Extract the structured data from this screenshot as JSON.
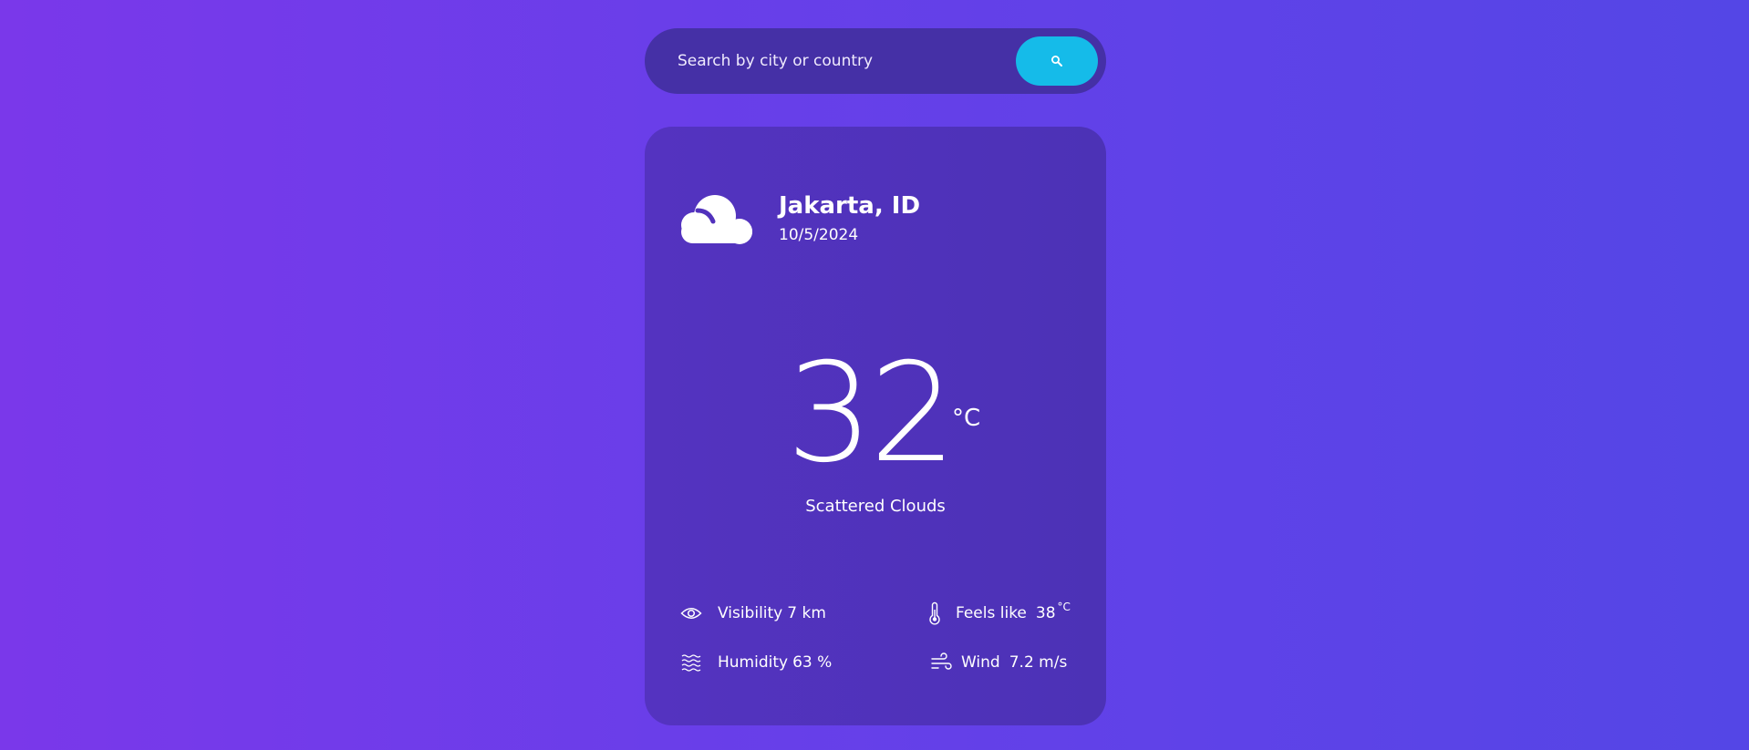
{
  "search": {
    "placeholder": "Search by city or country",
    "button_icon": "search-icon"
  },
  "weather": {
    "icon": "cloud-icon",
    "city": "Jakarta, ID",
    "date": "10/5/2024",
    "temperature": "32",
    "temperature_unit": "°C",
    "condition": "Scattered Clouds"
  },
  "stats": {
    "visibility": {
      "icon": "eye-icon",
      "label": "Visibility",
      "value": "7 km"
    },
    "humidity": {
      "icon": "waves-icon",
      "label": "Humidity",
      "value": "63 %"
    },
    "feels_like": {
      "icon": "thermometer-icon",
      "label": "Feels like",
      "value": "38",
      "unit": "°C"
    },
    "wind": {
      "icon": "wind-icon",
      "label": "Wind",
      "value": "7.2 m/s"
    }
  },
  "colors": {
    "background_start": "#7a38ea",
    "background_end": "#5446e6",
    "card": "#5131bc",
    "search_bar": "#4530a6",
    "accent": "#15bbe9"
  }
}
